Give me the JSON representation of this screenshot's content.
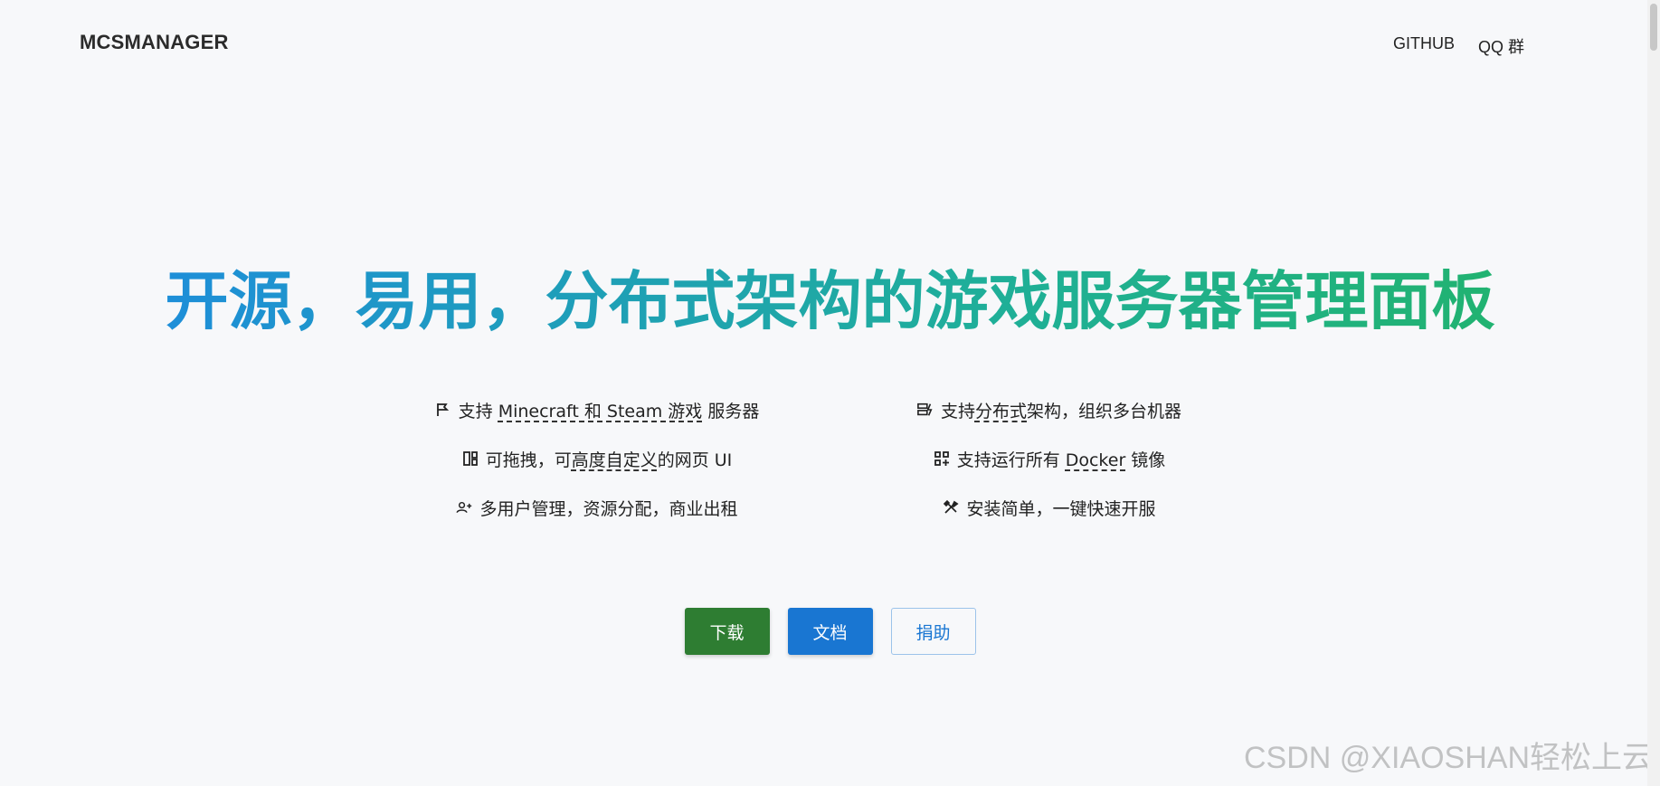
{
  "header": {
    "brand": "MCSMANAGER",
    "nav": [
      {
        "label": "GITHUB"
      },
      {
        "label": "QQ 群"
      }
    ]
  },
  "hero": {
    "title": "开源，易用，分布式架构的游戏服务器管理面板"
  },
  "features": [
    {
      "icon": "flag-icon",
      "parts": [
        "支持 ",
        "Minecraft 和 Steam 游戏",
        " 服务器"
      ]
    },
    {
      "icon": "server-nodes-icon",
      "parts": [
        "支持",
        "分布式",
        "架构，组织多台机器"
      ]
    },
    {
      "icon": "layout-icon",
      "parts": [
        "可拖拽，可",
        "高度自定义",
        "的网页 UI"
      ]
    },
    {
      "icon": "apps-add-icon",
      "parts": [
        "支持运行所有 ",
        "Docker",
        " 镜像"
      ]
    },
    {
      "icon": "user-add-icon",
      "parts": [
        "多用户管理，资源分配，商业出租"
      ]
    },
    {
      "icon": "tools-icon",
      "parts": [
        "安装简单，一键快速开服"
      ]
    }
  ],
  "buttons": {
    "download": "下载",
    "docs": "文档",
    "donate": "捐助"
  },
  "watermark": "CSDN @XIAOSHAN轻松上云",
  "colors": {
    "title_start": "#1e88e5",
    "title_end": "#22b464",
    "download_bg": "#2e7d32",
    "docs_bg": "#1976d2"
  }
}
